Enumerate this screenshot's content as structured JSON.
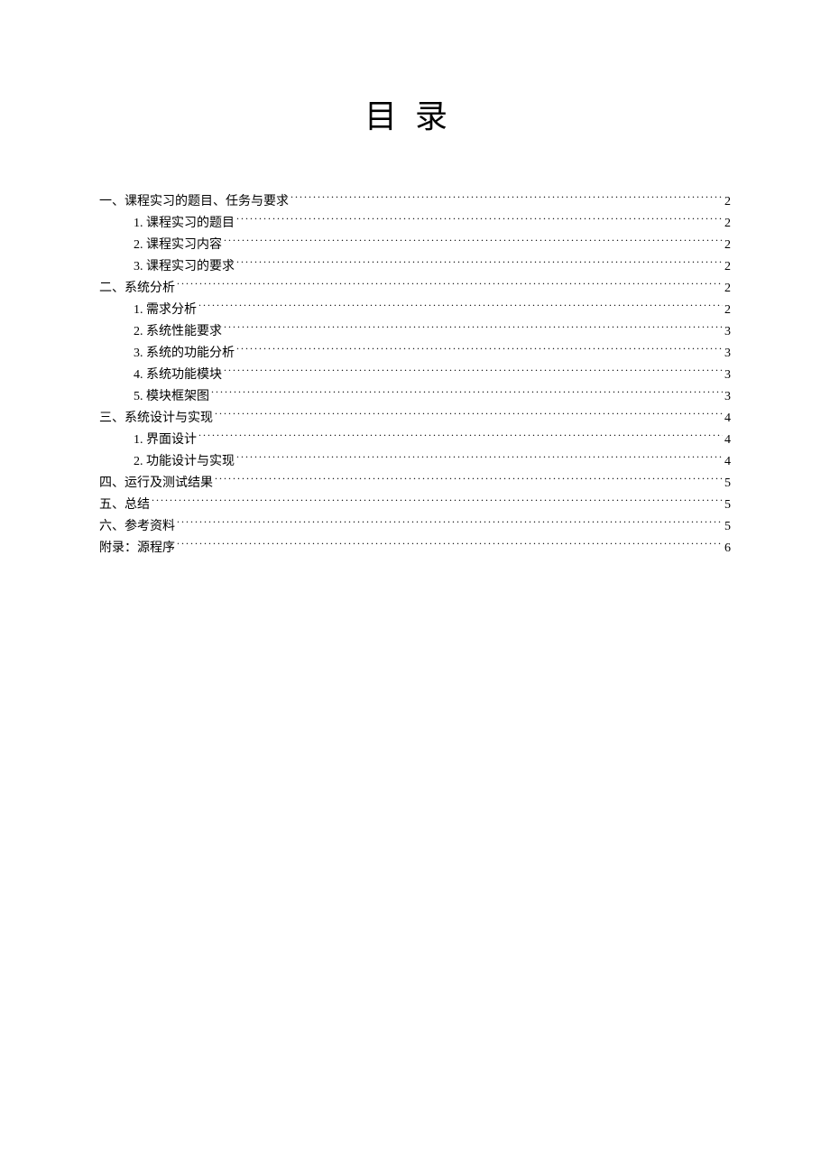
{
  "title": "目录",
  "entries": [
    {
      "level": 1,
      "label": "一、课程实习的题目、任务与要求",
      "page": "2"
    },
    {
      "level": 2,
      "label": "1. 课程实习的题目",
      "page": "2"
    },
    {
      "level": 2,
      "label": "2. 课程实习内容",
      "page": "2"
    },
    {
      "level": 2,
      "label": "3. 课程实习的要求",
      "page": "2"
    },
    {
      "level": 1,
      "label": "二、系统分析",
      "page": "2"
    },
    {
      "level": 2,
      "label": "1. 需求分析",
      "page": "2"
    },
    {
      "level": 2,
      "label": "2. 系统性能要求",
      "page": "3"
    },
    {
      "level": 2,
      "label": "3. 系统的功能分析",
      "page": "3"
    },
    {
      "level": 2,
      "label": "4. 系统功能模块",
      "page": "3"
    },
    {
      "level": 2,
      "label": "5. 模块框架图",
      "page": "3"
    },
    {
      "level": 1,
      "label": "三、系统设计与实现",
      "page": "4"
    },
    {
      "level": 2,
      "label": "1. 界面设计",
      "page": "4"
    },
    {
      "level": 2,
      "label": "2. 功能设计与实现",
      "page": "4"
    },
    {
      "level": 1,
      "label": "四、运行及测试结果",
      "page": "5"
    },
    {
      "level": 1,
      "label": "五、总结",
      "page": "5"
    },
    {
      "level": 1,
      "label": "六、参考资料",
      "page": "5"
    },
    {
      "level": 1,
      "label": "附录：源程序",
      "page": "6"
    }
  ]
}
